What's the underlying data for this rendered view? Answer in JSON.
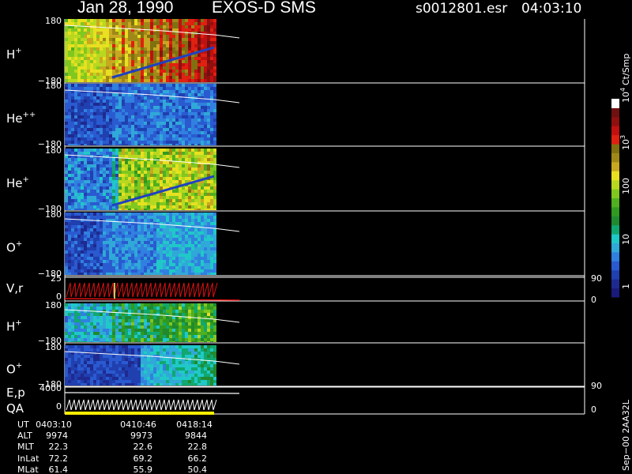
{
  "header": {
    "date": "Jan 28, 1990",
    "instrument": "EXOS-D SMS",
    "file": "s0012801.esr",
    "time": "04:03:10"
  },
  "colors": {
    "background": "#000000",
    "foreground": "#ffffff",
    "trace_red": "#e01010",
    "qa_yellow": "#ffee00"
  },
  "colorbar": {
    "unit_label": "Ct/Smp",
    "tick_labels": [
      "1",
      "10",
      "100",
      "10",
      "10"
    ],
    "tick_exponents": [
      "",
      "",
      "",
      "3",
      "4"
    ],
    "palette": [
      "#1a1a7a",
      "#1e2a90",
      "#2040b0",
      "#2a5ad0",
      "#3080e0",
      "#30a8d8",
      "#20c8c8",
      "#10a870",
      "#208a30",
      "#309a20",
      "#50b020",
      "#80c820",
      "#b8d820",
      "#e8e020",
      "#c8a820",
      "#a08818",
      "#807010",
      "#e02010",
      "#c01010",
      "#901010",
      "#701010",
      "#ffffff"
    ]
  },
  "panels": [
    {
      "label": "H",
      "sup": "+",
      "ymax": "180",
      "ymin": "−180",
      "fill": 1.0,
      "style": "hplus"
    },
    {
      "label": "He",
      "sup": "++",
      "ymax": "180",
      "ymin": "−180",
      "fill": 0.35,
      "style": "heplusplus"
    },
    {
      "label": "He",
      "sup": "+",
      "ymax": "180",
      "ymin": "−180",
      "fill": 0.75,
      "style": "heplus"
    },
    {
      "label": "O",
      "sup": "+",
      "ymax": "180",
      "ymin": "−180",
      "fill": 0.45,
      "style": "oplus"
    },
    {
      "label": "H",
      "sup": "+",
      "ymax": "180",
      "ymin": "−180",
      "fill": 0.6,
      "style": "hplus2"
    },
    {
      "label": "O",
      "sup": "+",
      "ymax": "180",
      "ymin": "−180",
      "fill": 0.4,
      "style": "oplus2"
    }
  ],
  "vr_panel": {
    "label": "V,r",
    "ymax": "25",
    "ymin": "0",
    "right_top": "90",
    "right_bottom": "0"
  },
  "ep_panel": {
    "label": "E,p",
    "ymax": "4000",
    "ymin": "0",
    "right_top": "90",
    "right_bottom": "0"
  },
  "qa_label": "QA",
  "orbit_table": {
    "rows": [
      {
        "name": "UT",
        "values": [
          "0403:10",
          "0410:46",
          "0418:14"
        ]
      },
      {
        "name": "ALT",
        "values": [
          "9974",
          "9973",
          "9844"
        ]
      },
      {
        "name": "MLT",
        "values": [
          "22.3",
          "22.6",
          "22.8"
        ]
      },
      {
        "name": "InLat",
        "values": [
          "72.2",
          "69.2",
          "66.2"
        ]
      },
      {
        "name": "MLat",
        "values": [
          "61.4",
          "55.9",
          "50.4"
        ]
      }
    ]
  },
  "footer_vertical": "Sep−00  2AA32L"
}
